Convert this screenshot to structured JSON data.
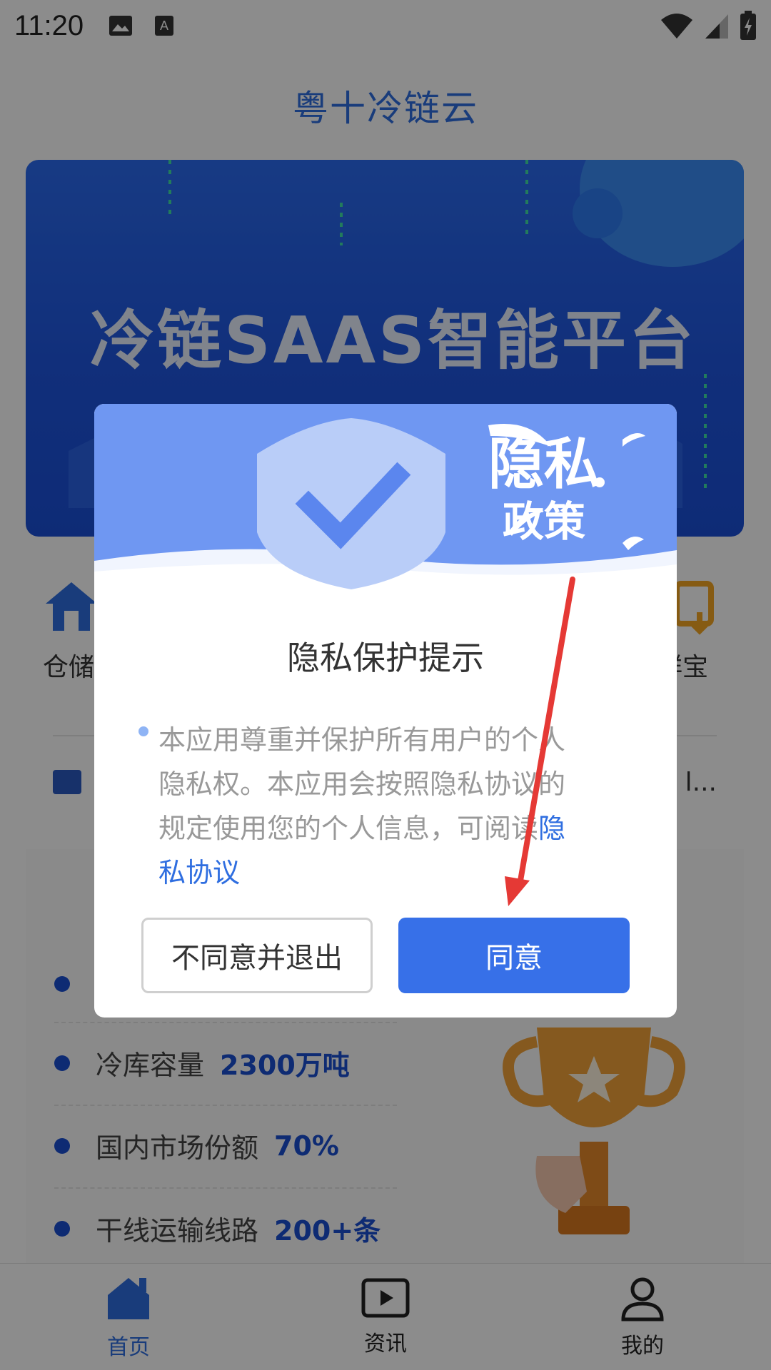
{
  "status_bar": {
    "time": "11:20"
  },
  "header": {
    "title": "粤十冷链云"
  },
  "banner": {
    "headline": "冷链SAAS智能平台"
  },
  "quick_nav": {
    "left_label": "仓储",
    "right_label": "鲜宝"
  },
  "notice": {
    "tail": "l..."
  },
  "stats": [
    {
      "label": "冷库容量",
      "value": "2300万吨"
    },
    {
      "label": "国内市场份额",
      "value": "70%"
    },
    {
      "label": "干线运输线路",
      "value": "200+条"
    }
  ],
  "bottom_nav": [
    {
      "label": "首页",
      "icon": "home-icon",
      "active": true
    },
    {
      "label": "资讯",
      "icon": "play-icon",
      "active": false
    },
    {
      "label": "我的",
      "icon": "profile-icon",
      "active": false
    }
  ],
  "dialog": {
    "header_line1": "隐私",
    "header_line2": "政策",
    "title": "隐私保护提示",
    "body": "本应用尊重并保护所有用户的个人隐私权。本应用会按照隐私协议的规定使用您的个人信息，可阅读",
    "link": "隐私协议",
    "decline_label": "不同意并退出",
    "accept_label": "同意"
  },
  "colors": {
    "brand": "#2f6ee0",
    "accept": "#3770e8",
    "annotation": "#e53935"
  }
}
